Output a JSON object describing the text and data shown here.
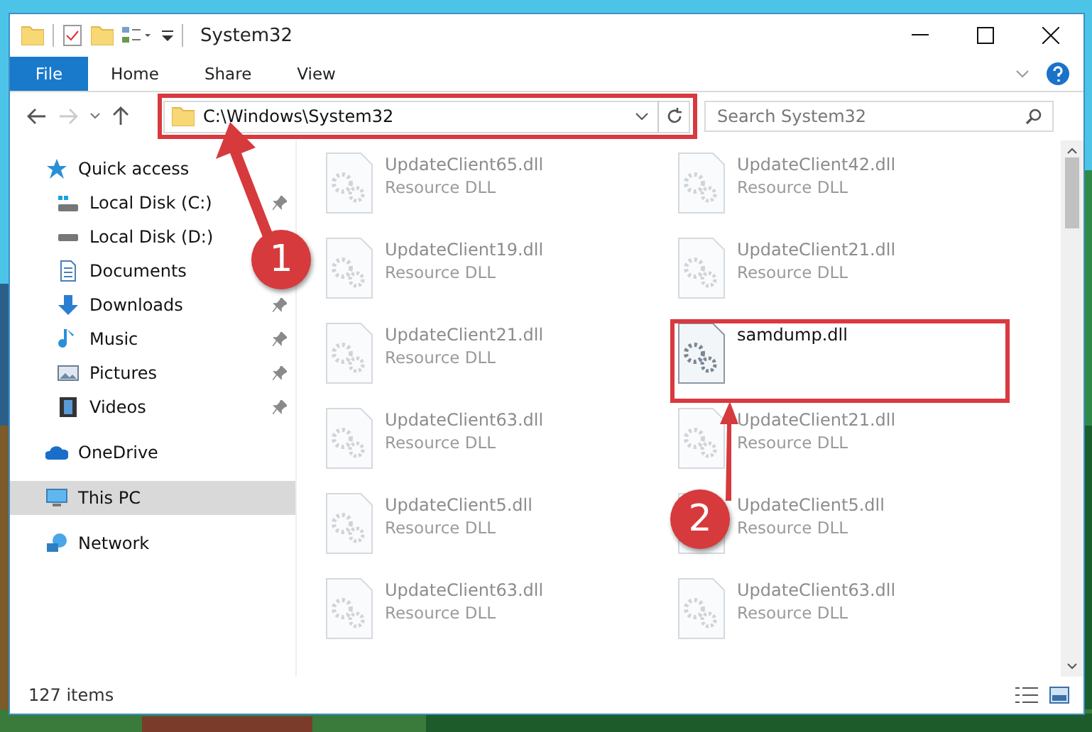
{
  "window": {
    "title": "System32"
  },
  "ribbon": {
    "tabs": [
      {
        "label": "File",
        "kind": "menu"
      },
      {
        "label": "Home",
        "kind": "tab"
      },
      {
        "label": "Share",
        "kind": "tab"
      },
      {
        "label": "View",
        "kind": "tab"
      }
    ]
  },
  "address_bar": {
    "path": "C:\\Windows\\System32"
  },
  "search": {
    "placeholder": "Search System32"
  },
  "navigation": [
    {
      "label": "Quick access",
      "kind": "star",
      "selected": false,
      "children": [
        {
          "label": "Local Disk (C:)",
          "kind": "system-drive",
          "pinned": true,
          "selected": false
        },
        {
          "label": "Local Disk (D:)",
          "kind": "drive",
          "selected": false
        },
        {
          "label": "Documents",
          "kind": "document",
          "selected": false
        },
        {
          "label": "Downloads",
          "kind": "download",
          "pinned": true,
          "selected": false
        },
        {
          "label": "Music",
          "kind": "music",
          "pinned": true,
          "selected": false
        },
        {
          "label": "Pictures",
          "kind": "pictures",
          "pinned": true,
          "selected": false
        },
        {
          "label": "Videos",
          "kind": "video",
          "pinned": true,
          "selected": false
        }
      ]
    },
    {
      "label": "OneDrive",
      "kind": "cloud",
      "selected": false
    },
    {
      "label": "This PC",
      "kind": "computer",
      "selected": true
    },
    {
      "label": "Network",
      "kind": "network",
      "selected": false
    }
  ],
  "files": [
    {
      "name": "UpdateClient65.dll",
      "type": "Resource DLL",
      "faded": true
    },
    {
      "name": "UpdateClient42.dll",
      "type": "Resource DLL",
      "faded": true
    },
    {
      "name": "UpdateClient19.dll",
      "type": "Resource DLL",
      "faded": true
    },
    {
      "name": "UpdateClient21.dll",
      "type": "Resource DLL",
      "faded": true
    },
    {
      "name": "UpdateClient21.dll",
      "type": "Resource DLL",
      "faded": true
    },
    {
      "name": "samdump.dll",
      "faded": false
    },
    {
      "name": "UpdateClient63.dll",
      "type": "Resource DLL",
      "faded": true
    },
    {
      "name": "UpdateClient21.dll",
      "type": "Resource DLL",
      "faded": true
    },
    {
      "name": "UpdateClient5.dll",
      "type": "Resource DLL",
      "faded": true
    },
    {
      "name": "UpdateClient5.dll",
      "type": "Resource DLL",
      "faded": true
    },
    {
      "name": "UpdateClient63.dll",
      "type": "Resource DLL",
      "faded": true
    },
    {
      "name": "UpdateClient63.dll",
      "type": "Resource DLL",
      "faded": true
    }
  ],
  "status_bar": {
    "item_count": "127 items"
  },
  "callouts": [
    {
      "number": "1"
    },
    {
      "number": "2"
    }
  ]
}
